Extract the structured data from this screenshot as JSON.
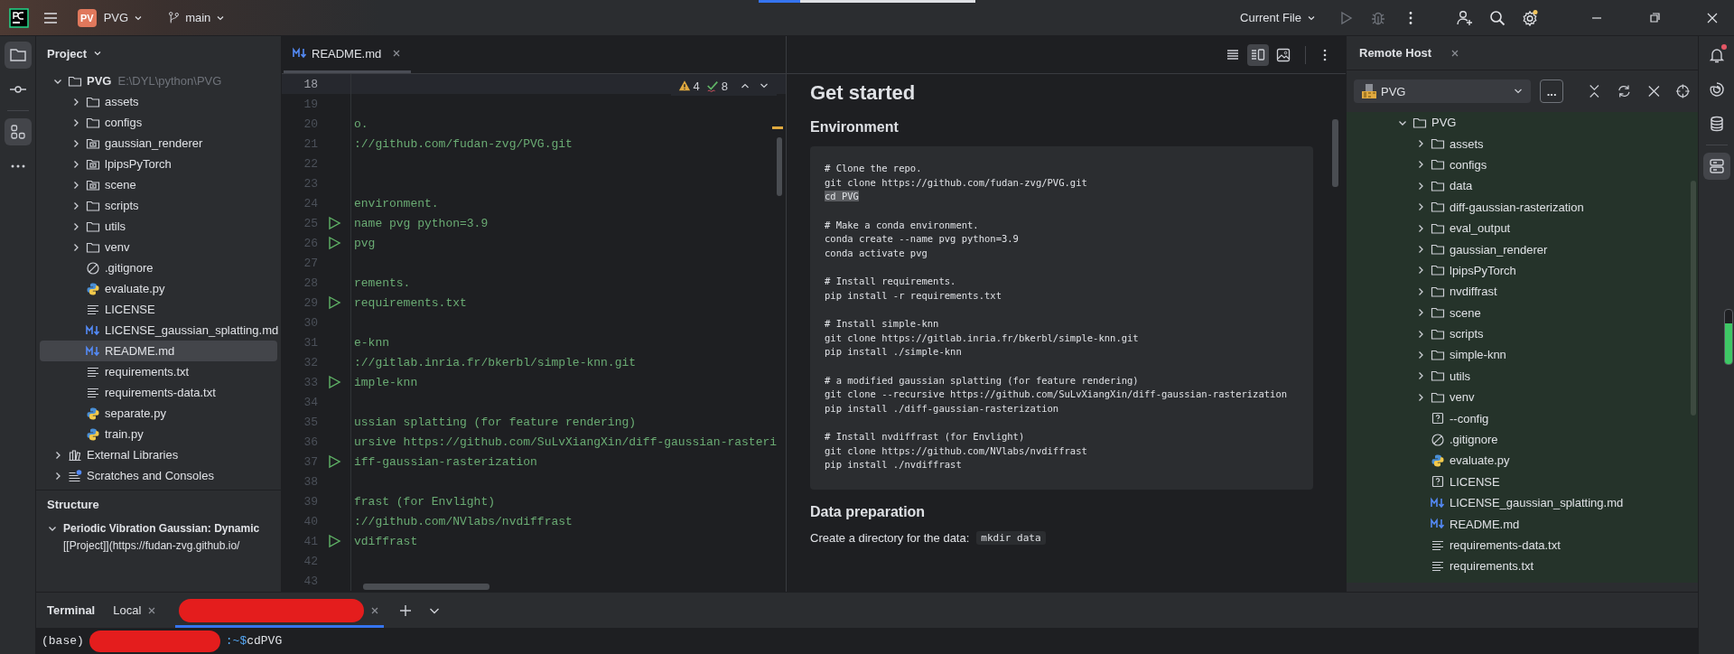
{
  "title_bar": {
    "project_badge": "PV",
    "project": "PVG",
    "branch": "main",
    "run_config": "Current File",
    "progress": {
      "level": 0.19
    }
  },
  "left_toolbar": [
    {
      "kind": "project",
      "selected": true
    },
    {
      "kind": "commit",
      "selected": false
    },
    {
      "kind": "structure",
      "selected": true
    },
    {
      "kind": "more",
      "selected": false
    }
  ],
  "project_panel": {
    "title": "Project",
    "tree": [
      {
        "name": "PVG",
        "path": "E:\\DYL\\python\\PVG",
        "kind": "folder",
        "expanded": true,
        "selected": false,
        "children": [
          {
            "name": "assets",
            "kind": "folder",
            "expanded": false,
            "selected": false
          },
          {
            "name": "configs",
            "kind": "folder",
            "expanded": false,
            "selected": false
          },
          {
            "name": "gaussian_renderer",
            "kind": "module",
            "expanded": false,
            "selected": false
          },
          {
            "name": "lpipsPyTorch",
            "kind": "module",
            "expanded": false,
            "selected": false
          },
          {
            "name": "scene",
            "kind": "module",
            "expanded": false,
            "selected": false
          },
          {
            "name": "scripts",
            "kind": "folder",
            "expanded": false,
            "selected": false
          },
          {
            "name": "utils",
            "kind": "folder",
            "expanded": false,
            "selected": false
          },
          {
            "name": "venv",
            "kind": "folder",
            "expanded": false,
            "selected": false
          },
          {
            "name": ".gitignore",
            "kind": "ignore",
            "selected": false
          },
          {
            "name": "evaluate.py",
            "kind": "python",
            "selected": false
          },
          {
            "name": "LICENSE",
            "kind": "text",
            "selected": false
          },
          {
            "name": "LICENSE_gaussian_splatting.md",
            "kind": "markdown",
            "selected": false
          },
          {
            "name": "README.md",
            "kind": "markdown",
            "selected": true
          },
          {
            "name": "requirements.txt",
            "kind": "text",
            "selected": false
          },
          {
            "name": "requirements-data.txt",
            "kind": "text",
            "selected": false
          },
          {
            "name": "separate.py",
            "kind": "python",
            "selected": false
          },
          {
            "name": "train.py",
            "kind": "python",
            "selected": false
          }
        ]
      },
      {
        "name": "External Libraries",
        "kind": "libraries",
        "expanded": false,
        "selected": false
      },
      {
        "name": "Scratches and Consoles",
        "kind": "scratches",
        "expanded": false,
        "selected": false
      }
    ]
  },
  "structure_panel": {
    "title": "Structure",
    "item": {
      "name": "Periodic Vibration Gaussian: Dynamic",
      "expanded": true,
      "child": "[[Project]](https://fudan-zvg.github.io/"
    }
  },
  "editor": {
    "tab": {
      "name": "README.md",
      "selected": true
    },
    "warnings": "4",
    "checks": "8",
    "lines": [
      {
        "number": "18",
        "current": true,
        "run": false
      },
      {
        "number": "19",
        "current": false,
        "run": false
      },
      {
        "number": "20",
        "text": "o.",
        "current": false,
        "run": false
      },
      {
        "number": "21",
        "text": "://github.com/fudan-zvg/PVG.git",
        "current": false,
        "run": false
      },
      {
        "number": "22",
        "current": false,
        "run": false
      },
      {
        "number": "23",
        "current": false,
        "run": false
      },
      {
        "number": "24",
        "text": "environment.",
        "current": false,
        "run": false
      },
      {
        "number": "25",
        "text": "name pvg python=3.9",
        "current": false,
        "run": true
      },
      {
        "number": "26",
        "text": "pvg",
        "current": false,
        "run": true
      },
      {
        "number": "27",
        "current": false,
        "run": false
      },
      {
        "number": "28",
        "text": "rements.",
        "current": false,
        "run": false
      },
      {
        "number": "29",
        "text": "requirements.txt",
        "current": false,
        "run": true
      },
      {
        "number": "30",
        "current": false,
        "run": false
      },
      {
        "number": "31",
        "text": "e-knn",
        "current": false,
        "run": false
      },
      {
        "number": "32",
        "text": "://gitlab.inria.fr/bkerbl/simple-knn.git",
        "current": false,
        "run": false
      },
      {
        "number": "33",
        "text": "imple-knn",
        "current": false,
        "run": true
      },
      {
        "number": "34",
        "current": false,
        "run": false
      },
      {
        "number": "35",
        "text": "ussian splatting (for feature rendering)",
        "current": false,
        "run": false
      },
      {
        "number": "36",
        "text": "ursive https://github.com/SuLvXiangXin/diff-gaussian-rasteri",
        "current": false,
        "run": false
      },
      {
        "number": "37",
        "text": "iff-gaussian-rasterization",
        "current": false,
        "run": true
      },
      {
        "number": "38",
        "current": false,
        "run": false
      },
      {
        "number": "39",
        "text": "frast (for Envlight)",
        "current": false,
        "run": false
      },
      {
        "number": "40",
        "text": "://github.com/NVlabs/nvdiffrast",
        "current": false,
        "run": false
      },
      {
        "number": "41",
        "text": "vdiffrast",
        "current": false,
        "run": true
      },
      {
        "number": "42",
        "current": false,
        "run": false
      },
      {
        "number": "43",
        "current": false,
        "run": false
      }
    ]
  },
  "preview": {
    "view_modes": [
      {
        "kind": "editor",
        "selected": false
      },
      {
        "kind": "split",
        "selected": true
      },
      {
        "kind": "preview",
        "selected": false
      }
    ],
    "heading": "Get started",
    "section_title": "Environment",
    "code": [
      [
        {
          "text": "# Clone the repo.",
          "highlighted": false
        },
        {
          "text": "git clone https://github.com/fudan-zvg/PVG.git",
          "highlighted": false
        },
        {
          "text": "cd PVG",
          "highlighted": true
        }
      ],
      [
        {
          "text": "# Make a conda environment.",
          "highlighted": false
        },
        {
          "text": "conda create --name pvg python=3.9",
          "highlighted": false
        },
        {
          "text": "conda activate pvg",
          "highlighted": false
        }
      ],
      [
        {
          "text": "# Install requirements.",
          "highlighted": false
        },
        {
          "text": "pip install -r requirements.txt",
          "highlighted": false
        }
      ],
      [
        {
          "text": "# Install simple-knn",
          "highlighted": false
        },
        {
          "text": "git clone https://gitlab.inria.fr/bkerbl/simple-knn.git",
          "highlighted": false
        },
        {
          "text": "pip install ./simple-knn",
          "highlighted": false
        }
      ],
      [
        {
          "text": "# a modified gaussian splatting (for feature rendering)",
          "highlighted": false
        },
        {
          "text": "git clone --recursive https://github.com/SuLvXiangXin/diff-gaussian-rasterization",
          "highlighted": false
        },
        {
          "text": "pip install ./diff-gaussian-rasterization",
          "highlighted": false
        }
      ],
      [
        {
          "text": "# Install nvdiffrast (for Envlight)",
          "highlighted": false
        },
        {
          "text": "git clone https://github.com/NVlabs/nvdiffrast",
          "highlighted": false
        },
        {
          "text": "pip install ./nvdiffrast",
          "highlighted": false
        }
      ]
    ],
    "section2_title": "Data preparation",
    "paragraph": "Create a directory for the data:",
    "inline_code": "mkdir data"
  },
  "remote_host": {
    "title": "Remote Host",
    "server": "PVG",
    "browse_button": "...",
    "tree": [
      {
        "name": "PVG",
        "kind": "folder",
        "expanded": true,
        "children": [
          {
            "name": "assets",
            "kind": "folder",
            "expanded": false
          },
          {
            "name": "configs",
            "kind": "folder",
            "expanded": false
          },
          {
            "name": "data",
            "kind": "folder",
            "expanded": false
          },
          {
            "name": "diff-gaussian-rasterization",
            "kind": "folder",
            "expanded": false
          },
          {
            "name": "eval_output",
            "kind": "folder",
            "expanded": false
          },
          {
            "name": "gaussian_renderer",
            "kind": "folder",
            "expanded": false
          },
          {
            "name": "lpipsPyTorch",
            "kind": "folder",
            "expanded": false
          },
          {
            "name": "nvdiffrast",
            "kind": "folder",
            "expanded": false
          },
          {
            "name": "scene",
            "kind": "folder",
            "expanded": false
          },
          {
            "name": "scripts",
            "kind": "folder",
            "expanded": false
          },
          {
            "name": "simple-knn",
            "kind": "folder",
            "expanded": false
          },
          {
            "name": "utils",
            "kind": "folder",
            "expanded": false
          },
          {
            "name": "venv",
            "kind": "folder",
            "expanded": false
          },
          {
            "name": "--config",
            "kind": "unknown"
          },
          {
            "name": ".gitignore",
            "kind": "ignore"
          },
          {
            "name": "evaluate.py",
            "kind": "python"
          },
          {
            "name": "LICENSE",
            "kind": "unknown"
          },
          {
            "name": "LICENSE_gaussian_splatting.md",
            "kind": "markdown"
          },
          {
            "name": "README.md",
            "kind": "markdown"
          },
          {
            "name": "requirements-data.txt",
            "kind": "text"
          },
          {
            "name": "requirements.txt",
            "kind": "text"
          }
        ]
      }
    ]
  },
  "right_toolbar": [
    {
      "kind": "notifications",
      "selected": false,
      "badge": true
    },
    {
      "kind": "assistant",
      "selected": false,
      "badge": false
    },
    {
      "kind": "database",
      "selected": false,
      "badge": false
    },
    {
      "kind": "remote",
      "selected": true,
      "badge": false
    }
  ],
  "memory_indicator": {
    "level": 0.75
  },
  "terminal": {
    "title": "Terminal",
    "tabs": [
      {
        "kind": "label",
        "label": "Local",
        "selected": false
      },
      {
        "kind": "redacted",
        "selected": true
      }
    ],
    "prompt": {
      "env": "(base)",
      "suffix": ":~$",
      "command": "cdPVG"
    }
  }
}
